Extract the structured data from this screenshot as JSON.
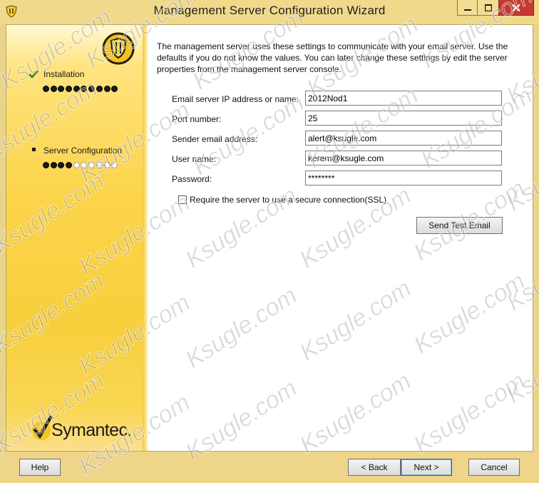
{
  "window": {
    "title": "Management Server Configuration Wizard"
  },
  "sidebar": {
    "steps": [
      {
        "label": "Installation",
        "state": "complete",
        "progress": 1.0,
        "dots_total": 10,
        "dots_filled": 10
      },
      {
        "label": "Server Configuration",
        "state": "current",
        "progress": 0.4,
        "dots_total": 10,
        "dots_filled": 4
      }
    ],
    "logo_text": "Symantec."
  },
  "main": {
    "description": "The management server uses these settings to communicate with your email server.  Use the defaults if you do not know the values. You can later change these settings by edit the server properties from the management server console.",
    "fields": [
      {
        "label": "Email server IP address or name:",
        "value": "2012Nod1"
      },
      {
        "label": "Port number:",
        "value": "25"
      },
      {
        "label": "Sender email address:",
        "value": "alert@ksugle.com"
      },
      {
        "label": "User name:",
        "value": "kerem@ksugle.com"
      },
      {
        "label": "Password:",
        "value": "********"
      }
    ],
    "ssl_checkbox_label": "Require the server to use a secure connection(SSL)",
    "ssl_checked": false,
    "send_test_label": "Send Test Email"
  },
  "buttons": {
    "help": "Help",
    "back": "< Back",
    "next": "Next >",
    "cancel": "Cancel"
  },
  "watermark": "Ksugle.com",
  "colors": {
    "accent_yellow": "#fbd44b",
    "check_green": "#2c8a1e",
    "close_red": "#c7392f"
  }
}
